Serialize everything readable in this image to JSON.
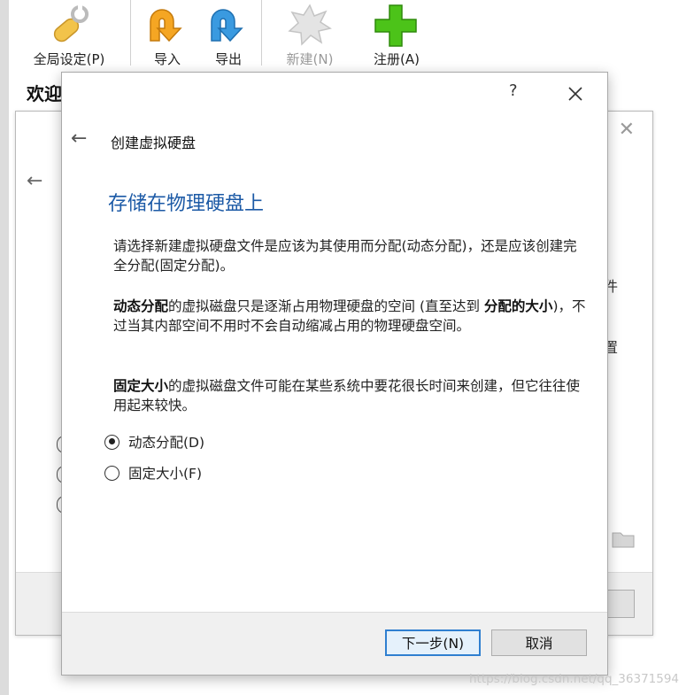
{
  "toolbar": {
    "global_settings": "全局设定(P)",
    "import": "导入",
    "export": "导出",
    "new": "新建(N)",
    "register": "注册(A)"
  },
  "welcome_text": "欢迎",
  "background_wizard": {
    "fragment_1": "件",
    "fragment_2": "置"
  },
  "dialog": {
    "help": "?",
    "back_title": "创建虚拟硬盘",
    "heading": "存储在物理硬盘上",
    "para1": "请选择新建虚拟硬盘文件是应该为其使用而分配(动态分配)，还是应该创建完全分配(固定分配)。",
    "para2_bold1": "动态分配",
    "para2_mid": "的虚拟磁盘只是逐渐占用物理硬盘的空间 (直至达到 ",
    "para2_bold2": "分配的大小",
    "para2_end": ")，不过当其内部空间不用时不会自动缩减占用的物理硬盘空间。",
    "para3_bold": "固定大小",
    "para3_end": "的虚拟磁盘文件可能在某些系统中要花很长时间来创建，但它往往使用起来较快。",
    "options": [
      {
        "label": "动态分配(D)",
        "checked": true
      },
      {
        "label": "固定大小(F)",
        "checked": false
      }
    ],
    "next_button": "下一步(N)",
    "cancel_button": "取消"
  },
  "watermark": "https://blog.csdn.net/qq_36371594",
  "colors": {
    "heading_blue": "#1c5aa6",
    "primary_border": "#2f7fd0",
    "plus_green": "#4cc319",
    "arrow_orange": "#f5a623",
    "arrow_blue": "#3a9ae0"
  }
}
